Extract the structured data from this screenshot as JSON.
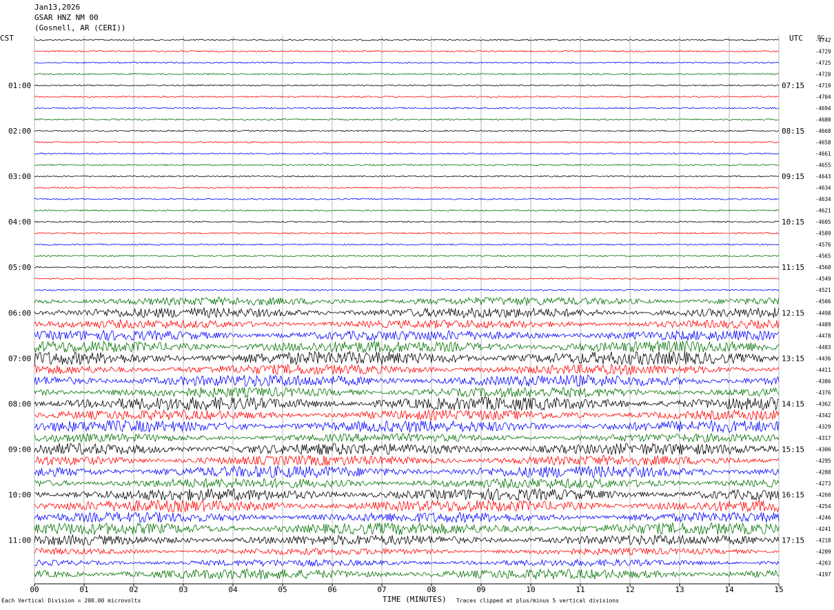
{
  "header": {
    "date": "Jan13,2026",
    "station": "GSAR HNZ NM 00",
    "location": "(Gosnell, AR (CERI))"
  },
  "left_tz": "CST",
  "right_tz": "UTC",
  "dc_label": "DC",
  "footer": {
    "scale_note": "Each Vertical Division =  200.00 microvolts",
    "x_title": "TIME (MINUTES)",
    "clip_note": "Traces clipped at plus/minus 5 vertical divisions"
  },
  "colors": {
    "trace_cycle": [
      "#000000",
      "#ff0000",
      "#0000ff",
      "#007000"
    ],
    "grid": "#888888"
  },
  "chart_data": {
    "type": "line",
    "title": "GSAR HNZ NM 00",
    "xlabel": "TIME (MINUTES)",
    "xlim": [
      0,
      15
    ],
    "x_ticks": [
      "00",
      "01",
      "02",
      "03",
      "04",
      "05",
      "06",
      "07",
      "08",
      "09",
      "10",
      "11",
      "12",
      "13",
      "14",
      "15"
    ],
    "left_hour_labels": [
      "01:00",
      "02:00",
      "03:00",
      "04:00",
      "05:00",
      "06:00",
      "07:00",
      "08:00",
      "09:00",
      "10:00",
      "11:00"
    ],
    "right_hour_labels": [
      "07:15",
      "08:15",
      "09:15",
      "10:15",
      "11:15",
      "12:15",
      "13:15",
      "14:15",
      "15:15",
      "16:15",
      "17:15"
    ],
    "dc_offsets": [
      -4742,
      -4729,
      -4725,
      -4720,
      -4719,
      -4704,
      -4694,
      -4680,
      -4668,
      -4658,
      -4661,
      -4655,
      -4643,
      -4634,
      -4634,
      -4621,
      -4605,
      -4589,
      -4576,
      -4565,
      -4560,
      -4549,
      -4521,
      -4506,
      -4498,
      -4489,
      -4478,
      -4483,
      -4436,
      -4411,
      -4386,
      -4376,
      -4362,
      -4342,
      -4329,
      -4317,
      -4306,
      -4295,
      -4288,
      -4273,
      -4260,
      -4254,
      -4246,
      -4241,
      -4218,
      -4209,
      -4203,
      -4197
    ],
    "noise_level_per_row": [
      1,
      1,
      1,
      1,
      1,
      1,
      1,
      1,
      1,
      1,
      1,
      1,
      1,
      1,
      1,
      1,
      1,
      1,
      1,
      1,
      1,
      1,
      1,
      5,
      6,
      5,
      6,
      7,
      8,
      6,
      7,
      6,
      8,
      6,
      7,
      5,
      7,
      6,
      7,
      6,
      7,
      7,
      6,
      7,
      6,
      4,
      4,
      6
    ],
    "annotations": [
      "Each Vertical Division =  200.00 microvolts",
      "Traces clipped at plus/minus 5 vertical divisions"
    ]
  }
}
